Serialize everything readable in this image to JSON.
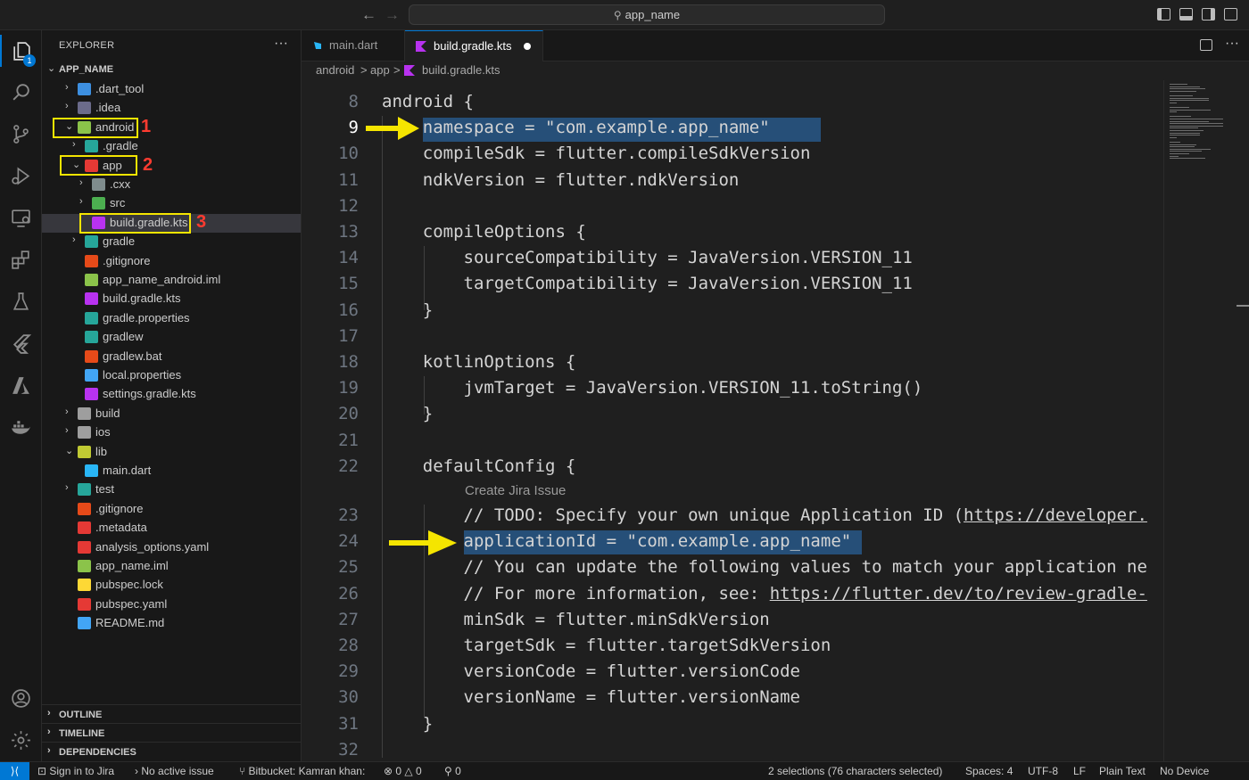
{
  "titlebar": {
    "search_text": "app_name",
    "back_arrow": "←",
    "forward_arrow": "→"
  },
  "activity": {
    "explorer_badge": "1"
  },
  "sidebar": {
    "title": "EXPLORER",
    "more": "···",
    "root_label": "APP_NAME",
    "tree": [
      {
        "label": ".dart_tool",
        "chev": "›",
        "icon_color": "#3d8fe0"
      },
      {
        "label": ".idea",
        "chev": "›",
        "icon_color": "#6b6b8a"
      },
      {
        "label": "android",
        "chev": "⌄",
        "icon_color": "#8bc34a"
      },
      {
        "label": ".gradle",
        "chev": "›",
        "icon_color": "#26a69a"
      },
      {
        "label": "app",
        "chev": "⌄",
        "icon_color": "#e53935"
      },
      {
        "label": ".cxx",
        "chev": "›",
        "icon_color": "#7f8c8d"
      },
      {
        "label": "src",
        "chev": "›",
        "icon_color": "#4caf50"
      },
      {
        "label": "build.gradle.kts",
        "chev": "",
        "icon_color": "#b832f0"
      },
      {
        "label": "gradle",
        "chev": "›",
        "icon_color": "#26a69a"
      },
      {
        "label": ".gitignore",
        "chev": "",
        "icon_color": "#e64a19"
      },
      {
        "label": "app_name_android.iml",
        "chev": "",
        "icon_color": "#8bc34a"
      },
      {
        "label": "build.gradle.kts",
        "chev": "",
        "icon_color": "#b832f0"
      },
      {
        "label": "gradle.properties",
        "chev": "",
        "icon_color": "#26a69a"
      },
      {
        "label": "gradlew",
        "chev": "",
        "icon_color": "#26a69a"
      },
      {
        "label": "gradlew.bat",
        "chev": "",
        "icon_color": "#e64a19"
      },
      {
        "label": "local.properties",
        "chev": "",
        "icon_color": "#42a5f5"
      },
      {
        "label": "settings.gradle.kts",
        "chev": "",
        "icon_color": "#b832f0"
      },
      {
        "label": "build",
        "chev": "›",
        "icon_color": "#9e9e9e"
      },
      {
        "label": "ios",
        "chev": "›",
        "icon_color": "#9e9e9e"
      },
      {
        "label": "lib",
        "chev": "⌄",
        "icon_color": "#c0ca33"
      },
      {
        "label": "main.dart",
        "chev": "",
        "icon_color": "#29b6f6"
      },
      {
        "label": "test",
        "chev": "›",
        "icon_color": "#26a69a"
      },
      {
        "label": ".gitignore",
        "chev": "",
        "icon_color": "#e64a19"
      },
      {
        "label": ".metadata",
        "chev": "",
        "icon_color": "#e53935"
      },
      {
        "label": "analysis_options.yaml",
        "chev": "",
        "icon_color": "#e53935"
      },
      {
        "label": "app_name.iml",
        "chev": "",
        "icon_color": "#8bc34a"
      },
      {
        "label": "pubspec.lock",
        "chev": "",
        "icon_color": "#fdd835"
      },
      {
        "label": "pubspec.yaml",
        "chev": "",
        "icon_color": "#e53935"
      },
      {
        "label": "README.md",
        "chev": "",
        "icon_color": "#42a5f5"
      }
    ],
    "sections": [
      "OUTLINE",
      "TIMELINE",
      "DEPENDENCIES"
    ],
    "annotations": [
      "1",
      "2",
      "3"
    ]
  },
  "tabs": [
    {
      "label": "main.dart"
    },
    {
      "label": "build.gradle.kts"
    }
  ],
  "breadcrumb": [
    "android",
    "app",
    "build.gradle.kts"
  ],
  "breadcrumb_sep": ">",
  "editor": {
    "codelens": "Create Jira Issue",
    "lines": [
      {
        "num": "8",
        "text": "android {"
      },
      {
        "num": "9",
        "text": "    namespace = \"com.example.app_name\""
      },
      {
        "num": "10",
        "text": "    compileSdk = flutter.compileSdkVersion"
      },
      {
        "num": "11",
        "text": "    ndkVersion = flutter.ndkVersion"
      },
      {
        "num": "12",
        "text": ""
      },
      {
        "num": "13",
        "text": "    compileOptions {"
      },
      {
        "num": "14",
        "text": "        sourceCompatibility = JavaVersion.VERSION_11"
      },
      {
        "num": "15",
        "text": "        targetCompatibility = JavaVersion.VERSION_11"
      },
      {
        "num": "16",
        "text": "    }"
      },
      {
        "num": "17",
        "text": ""
      },
      {
        "num": "18",
        "text": "    kotlinOptions {"
      },
      {
        "num": "19",
        "text": "        jvmTarget = JavaVersion.VERSION_11.toString()"
      },
      {
        "num": "20",
        "text": "    }"
      },
      {
        "num": "21",
        "text": ""
      },
      {
        "num": "22",
        "text": "    defaultConfig {"
      },
      {
        "num": "23",
        "text": "        // TODO: Specify your own unique Application ID (",
        "link": "https://developer."
      },
      {
        "num": "24",
        "text": "        applicationId = \"com.example.app_name\""
      },
      {
        "num": "25",
        "text": "        // You can update the following values to match your application ne"
      },
      {
        "num": "26",
        "text": "        // For more information, see: ",
        "link": "https://flutter.dev/to/review-gradle-"
      },
      {
        "num": "27",
        "text": "        minSdk = flutter.minSdkVersion"
      },
      {
        "num": "28",
        "text": "        targetSdk = flutter.targetSdkVersion"
      },
      {
        "num": "29",
        "text": "        versionCode = flutter.versionCode"
      },
      {
        "num": "30",
        "text": "        versionName = flutter.versionName"
      },
      {
        "num": "31",
        "text": "    }"
      },
      {
        "num": "32",
        "text": ""
      }
    ]
  },
  "statusbar": {
    "remote": "⟩⟨",
    "jira": "Sign in to Jira",
    "issue": "No active issue",
    "bitbucket": "Bitbucket: Kamran khan:",
    "errors": "0",
    "warnings": "0",
    "ports": "0",
    "selection": "2 selections (76 characters selected)",
    "spaces": "Spaces: 4",
    "encoding": "UTF-8",
    "eol": "LF",
    "language": "Plain Text",
    "device": "No Device"
  },
  "colors": {
    "accent": "#0078d4",
    "highlight": "#f5e500",
    "annotation": "#ff3b30",
    "selection": "#264f78"
  }
}
